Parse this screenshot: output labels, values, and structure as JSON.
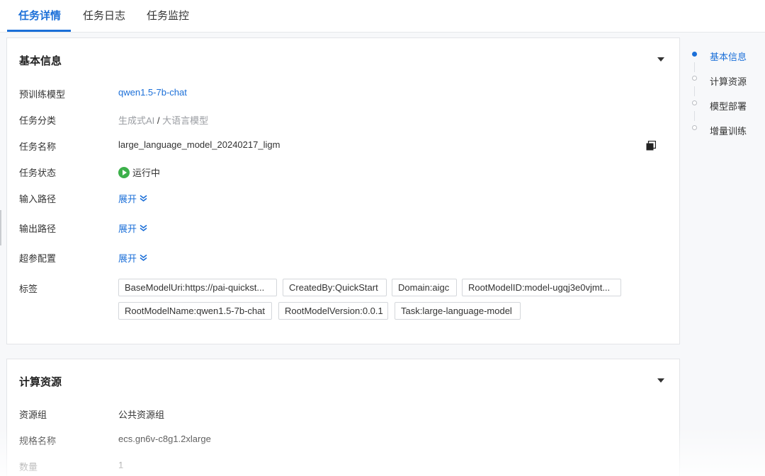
{
  "tabs": [
    {
      "label": "任务详情",
      "active": true
    },
    {
      "label": "任务日志",
      "active": false
    },
    {
      "label": "任务监控",
      "active": false
    }
  ],
  "basic": {
    "title": "基本信息",
    "fields": {
      "pretrained_model": {
        "label": "预训练模型",
        "value": "qwen1.5-7b-chat"
      },
      "category": {
        "label": "任务分类",
        "value_primary": "生成式AI",
        "separator": " / ",
        "value_secondary": "大语言模型"
      },
      "task_name": {
        "label": "任务名称",
        "value": "large_language_model_20240217_ligm"
      },
      "task_status": {
        "label": "任务状态",
        "value": "运行中"
      },
      "input_path": {
        "label": "输入路径",
        "action": "展开"
      },
      "output_path": {
        "label": "输出路径",
        "action": "展开"
      },
      "hyperparams": {
        "label": "超参配置",
        "action": "展开"
      },
      "tags": {
        "label": "标签",
        "items": [
          "BaseModelUri:https://pai-quickst...",
          "CreatedBy:QuickStart",
          "Domain:aigc",
          "RootModelID:model-ugqj3e0vjmt...",
          "RootModelName:qwen1.5-7b-chat",
          "RootModelVersion:0.0.1",
          "Task:large-language-model"
        ]
      }
    }
  },
  "compute": {
    "title": "计算资源",
    "fields": {
      "resource_group": {
        "label": "资源组",
        "value": "公共资源组"
      },
      "spec_name": {
        "label": "规格名称",
        "value": "ecs.gn6v-c8g1.2xlarge"
      },
      "quantity": {
        "label": "数量",
        "value": "1"
      }
    }
  },
  "anchor_nav": [
    {
      "label": "基本信息",
      "active": true
    },
    {
      "label": "计算资源",
      "active": false
    },
    {
      "label": "模型部署",
      "active": false
    },
    {
      "label": "增量训练",
      "active": false
    }
  ],
  "colors": {
    "accent": "#1b6fd8",
    "status_running": "#3cb04a",
    "muted": "#9a9da2"
  }
}
